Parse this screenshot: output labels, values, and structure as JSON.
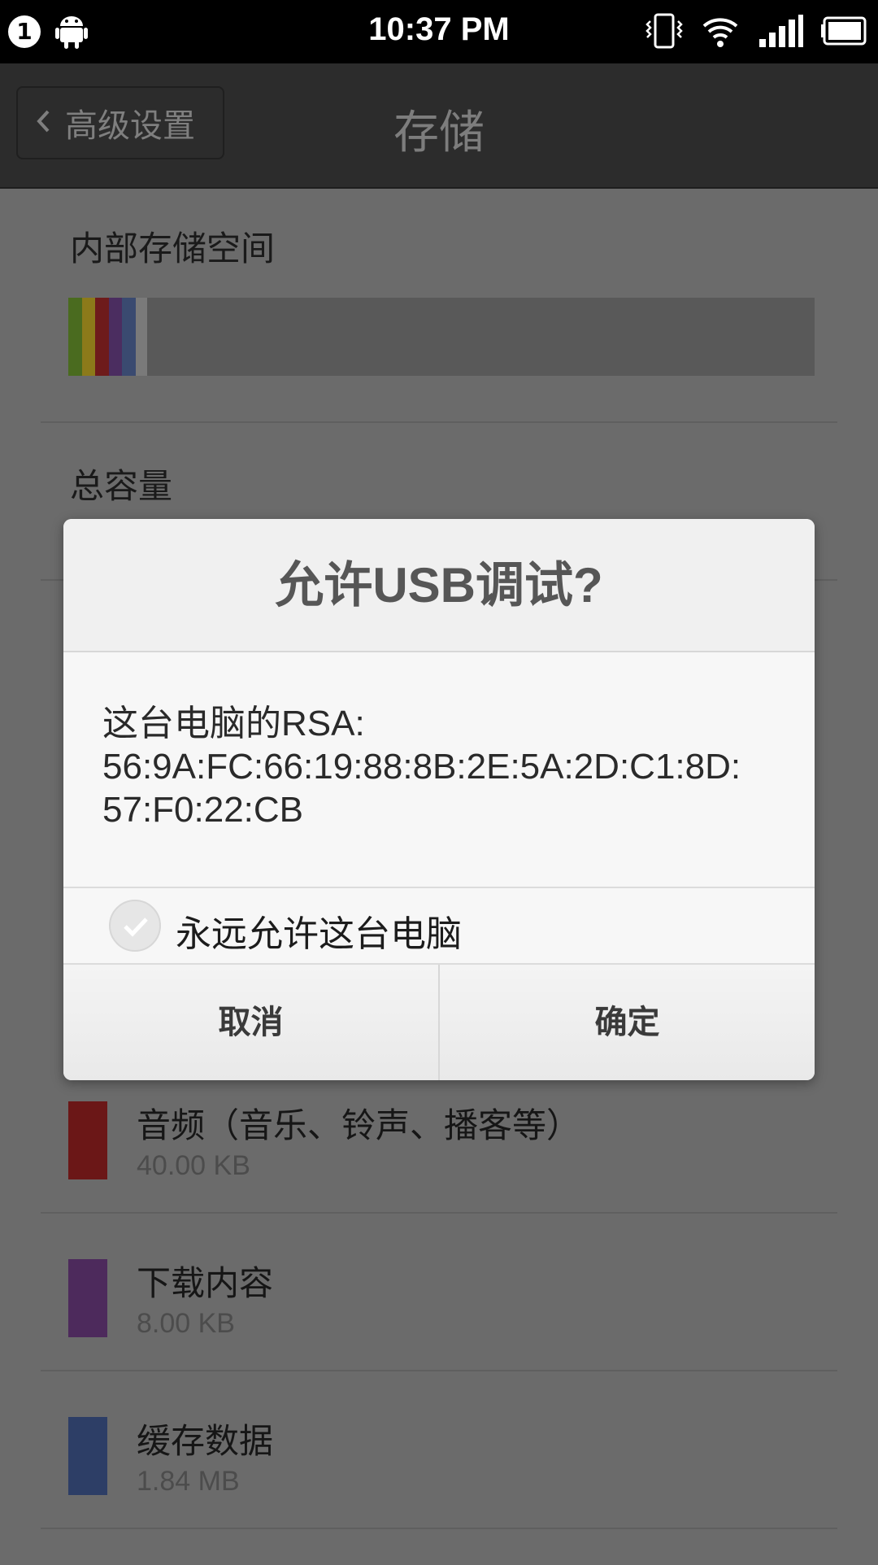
{
  "status_bar": {
    "notification_count": "1",
    "time": "10:37 PM",
    "icons": [
      "android-icon",
      "vibrate-icon",
      "wifi-icon",
      "signal-icon",
      "battery-icon"
    ]
  },
  "action_bar": {
    "back_label": "高级设置",
    "title": "存储"
  },
  "storage": {
    "section_title": "内部存储空间",
    "bar_segments": [
      {
        "color": "#4a6b1f",
        "fraction": 0.018
      },
      {
        "color": "#8c7a1a",
        "fraction": 0.018
      },
      {
        "color": "#6e1b1b",
        "fraction": 0.018
      },
      {
        "color": "#4b2d60",
        "fraction": 0.018
      },
      {
        "color": "#3a4a70",
        "fraction": 0.018
      },
      {
        "color": "#7a7a7a",
        "fraction": 0.016
      }
    ],
    "total_label": "总容量",
    "categories": [
      {
        "name": "音频（音乐、铃声、播客等）",
        "size": "40.00 KB",
        "color": "#6b1717"
      },
      {
        "name": "下载内容",
        "size": "8.00 KB",
        "color": "#4d2a5c"
      },
      {
        "name": "缓存数据",
        "size": "1.84 MB",
        "color": "#2d3e66"
      }
    ]
  },
  "dialog": {
    "title": "允许USB调试?",
    "message_line1": "这台电脑的RSA:",
    "message_line2": "56:9A:FC:66:19:88:8B:2E:5A:2D:C1:8D:",
    "message_line3": "57:F0:22:CB",
    "checkbox_label": "永远允许这台电脑",
    "cancel_label": "取消",
    "ok_label": "确定"
  }
}
